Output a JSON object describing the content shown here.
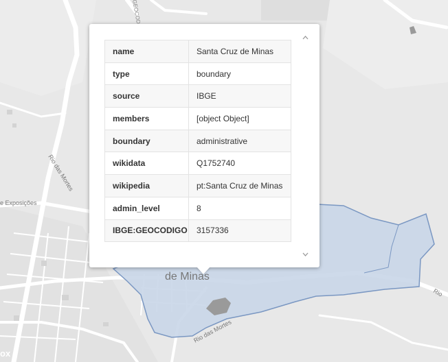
{
  "map": {
    "city_label": "de Minas",
    "road_labels": {
      "rio_das_mortes_left": "Rio das Mortes",
      "rio_das_mortes_bottom": "Rio das Mortes",
      "exposicoes": "e Exposições",
      "geocod": "GEOCOD",
      "rio_right": "Rio"
    },
    "corner_text": "ox",
    "colors": {
      "boundary_fill": "#c9d6e8",
      "boundary_stroke": "#7a97c2",
      "roads": "#ffffff",
      "water": "#9a9a9a"
    }
  },
  "popup": {
    "rows": [
      {
        "key": "name",
        "value": "Santa Cruz de Minas"
      },
      {
        "key": "type",
        "value": "boundary"
      },
      {
        "key": "source",
        "value": "IBGE"
      },
      {
        "key": "members",
        "value": "[object Object]"
      },
      {
        "key": "boundary",
        "value": "administrative"
      },
      {
        "key": "wikidata",
        "value": "Q1752740"
      },
      {
        "key": "wikipedia",
        "value": "pt:Santa Cruz de Minas"
      },
      {
        "key": "admin_level",
        "value": "8"
      },
      {
        "key": "IBGE:GEOCODIGO",
        "value": "3157336"
      }
    ],
    "scroll_up_icon": "chevron-up-icon",
    "scroll_down_icon": "chevron-down-icon"
  }
}
